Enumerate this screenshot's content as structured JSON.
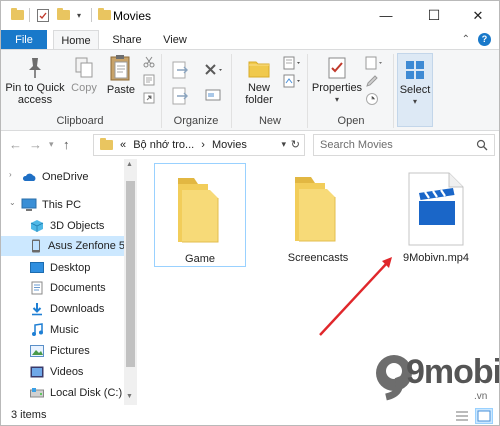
{
  "window": {
    "title": "Movies",
    "minimize": "—",
    "maximize": "☐",
    "close": "✕"
  },
  "ribbon_tabs": [
    "File",
    "Home",
    "Share",
    "View"
  ],
  "ribbon": {
    "pin": "Pin to Quick access",
    "copy": "Copy",
    "paste": "Paste",
    "new_folder": "New folder",
    "properties": "Properties",
    "select": "Select",
    "groups": [
      "Clipboard",
      "Organize",
      "New",
      "Open"
    ]
  },
  "address": {
    "crumbs": [
      "«",
      "Bộ nhớ tro...",
      "›",
      "Movies"
    ],
    "search_placeholder": "Search Movies"
  },
  "nav": {
    "items": [
      {
        "label": "OneDrive",
        "icon": "cloud-icon"
      },
      {
        "label": "This PC",
        "icon": "pc-icon"
      },
      {
        "label": "3D Objects",
        "icon": "cube-icon"
      },
      {
        "label": "Asus Zenfone 5",
        "icon": "phone-icon"
      },
      {
        "label": "Desktop",
        "icon": "desktop-icon"
      },
      {
        "label": "Documents",
        "icon": "documents-icon"
      },
      {
        "label": "Downloads",
        "icon": "download-icon"
      },
      {
        "label": "Music",
        "icon": "music-icon"
      },
      {
        "label": "Pictures",
        "icon": "pictures-icon"
      },
      {
        "label": "Videos",
        "icon": "videos-icon"
      },
      {
        "label": "Local Disk (C:)",
        "icon": "disk-icon"
      }
    ]
  },
  "files": [
    {
      "name": "Game",
      "type": "folder"
    },
    {
      "name": "Screencasts",
      "type": "folder"
    },
    {
      "name": "9Mobivn.mp4",
      "type": "video"
    }
  ],
  "status": {
    "items": "3 items"
  },
  "watermark": {
    "brand": "9mobi",
    "tld": ".vn"
  },
  "colors": {
    "accent": "#1979ca",
    "folder": "#f0c94c",
    "arrow": "#e0272b",
    "selection": "#cce8ff"
  }
}
